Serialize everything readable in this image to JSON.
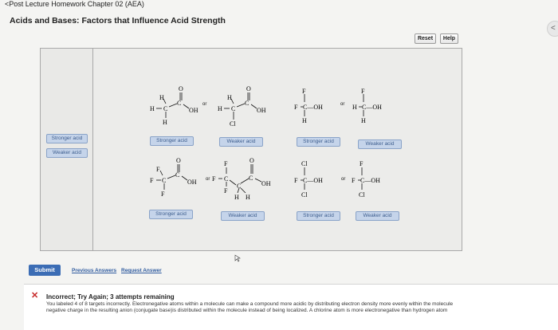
{
  "header": {
    "back_link": "<Post Lecture Homework Chapter 02 (AEA)",
    "title": "Acids and Bases: Factors that Influence Acid Strength"
  },
  "toolbar": {
    "reset_label": "Reset",
    "help_label": "Help"
  },
  "pool": {
    "items": [
      "Stronger acid",
      "Weaker acid"
    ]
  },
  "pairs": [
    {
      "targets": [
        "Stronger acid",
        "Weaker acid"
      ],
      "separator": "or"
    },
    {
      "targets": [
        "Stronger acid",
        "Weaker acid"
      ],
      "separator": "or"
    },
    {
      "targets": [
        "Stronger acid",
        "Weaker acid"
      ],
      "separator": "or"
    },
    {
      "targets": [
        "Stronger acid",
        "Weaker acid"
      ],
      "separator": "or"
    }
  ],
  "atoms": {
    "H": "H",
    "C": "C",
    "O": "O",
    "OH": "OH",
    "F": "F",
    "Cl": "Cl",
    "COH": "C—OH"
  },
  "actions": {
    "submit_label": "Submit",
    "previous_answers": "Previous Answers",
    "request_answer": "Request Answer"
  },
  "feedback": {
    "icon": "close-icon",
    "title": "Incorrect; Try Again; 3 attempts remaining",
    "line1": "You labeled 4 of 8 targets incorrectly. Electronegative atoms within a molecule can make a compound more acidic by distributing electron density more evenly within the molecule",
    "line2": "negative charge in the resulting anion (conjugate base)is distributed within the molecule instead of being localized. A chlorine atom is more electronegative than hydrogen atom"
  },
  "colors": {
    "accent": "#3c6db5",
    "label_bg": "#c5d4ea",
    "label_text": "#3e5e8e",
    "error": "#c62828"
  }
}
